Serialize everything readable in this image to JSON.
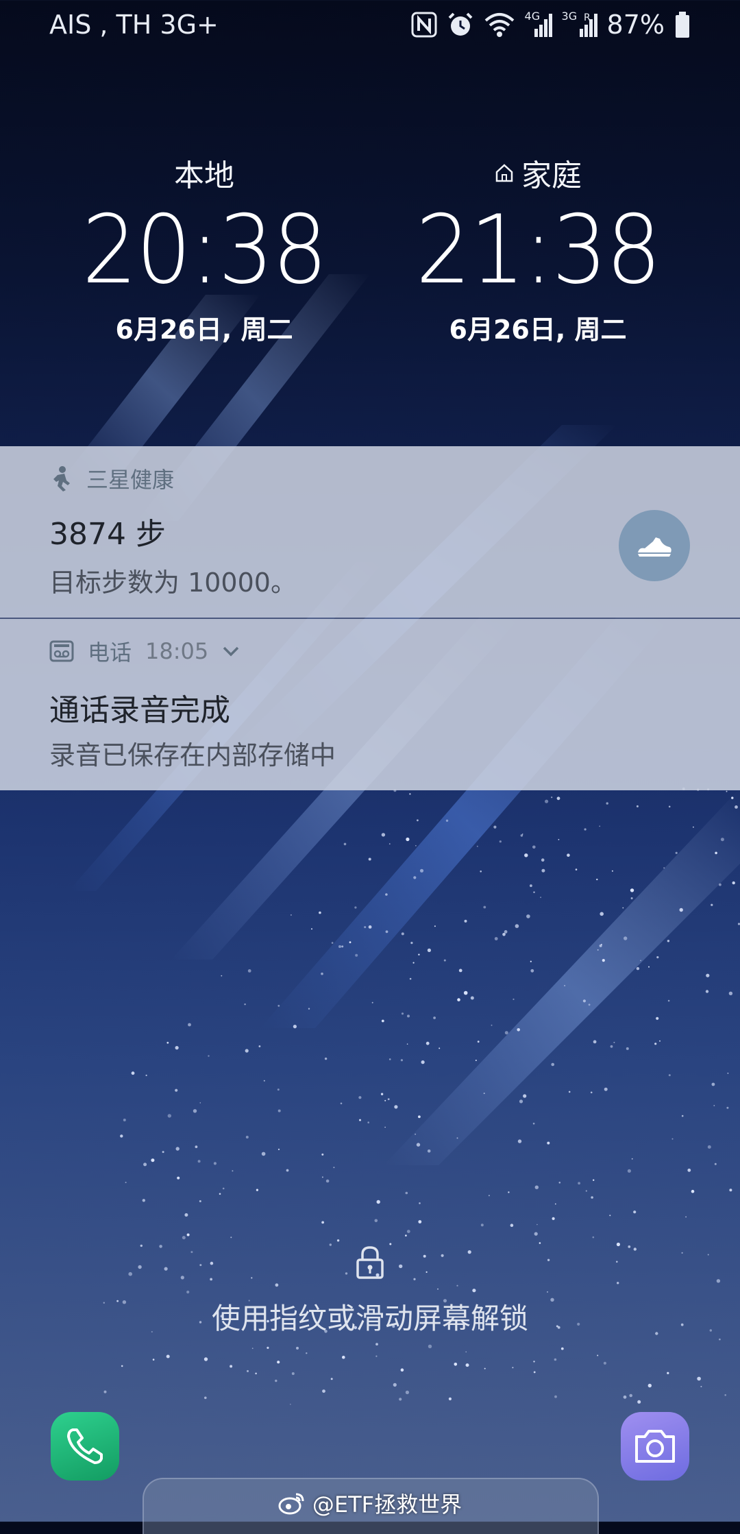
{
  "status_bar": {
    "carrier": "AIS , TH 3G+",
    "icons": [
      "nfc-icon",
      "alarm-icon",
      "wifi-icon",
      "signal-4g-icon",
      "signal-3g-roaming-icon",
      "battery-icon"
    ],
    "net_label_1": "4G",
    "net_label_2": "3G",
    "roaming_label": "R",
    "battery_percent": "87%"
  },
  "clocks": {
    "local": {
      "label": "本地",
      "time": "20:38",
      "date": "6月26日, 周二"
    },
    "home": {
      "label": "家庭",
      "icon": "home-icon",
      "time": "21:38",
      "date": "6月26日, 周二"
    }
  },
  "notifications": {
    "health": {
      "app_name": "三星健康",
      "app_icon": "samsung-health-icon",
      "title": "3874 步",
      "text": "目标步数为 10000。",
      "action_icon": "shoe-icon"
    },
    "phone": {
      "app_name": "电话",
      "app_icon": "voicemail-icon",
      "time": "18:05",
      "expand_icon": "chevron-down-icon",
      "title": "通话录音完成",
      "text": "录音已保存在内部存储中"
    }
  },
  "lock": {
    "icon": "lock-icon",
    "hint": "使用指纹或滑动屏幕解锁"
  },
  "shortcuts": {
    "left": "phone-icon",
    "right": "camera-icon"
  },
  "watermark": {
    "icon": "weibo-icon",
    "text": "@ETF拯救世界"
  },
  "colors": {
    "health_action_bg": "#7f9ab6",
    "phone_shortcut": "#1fb878",
    "camera_shortcut": "#8a80ea",
    "notification_bg": "#ced4e2"
  }
}
